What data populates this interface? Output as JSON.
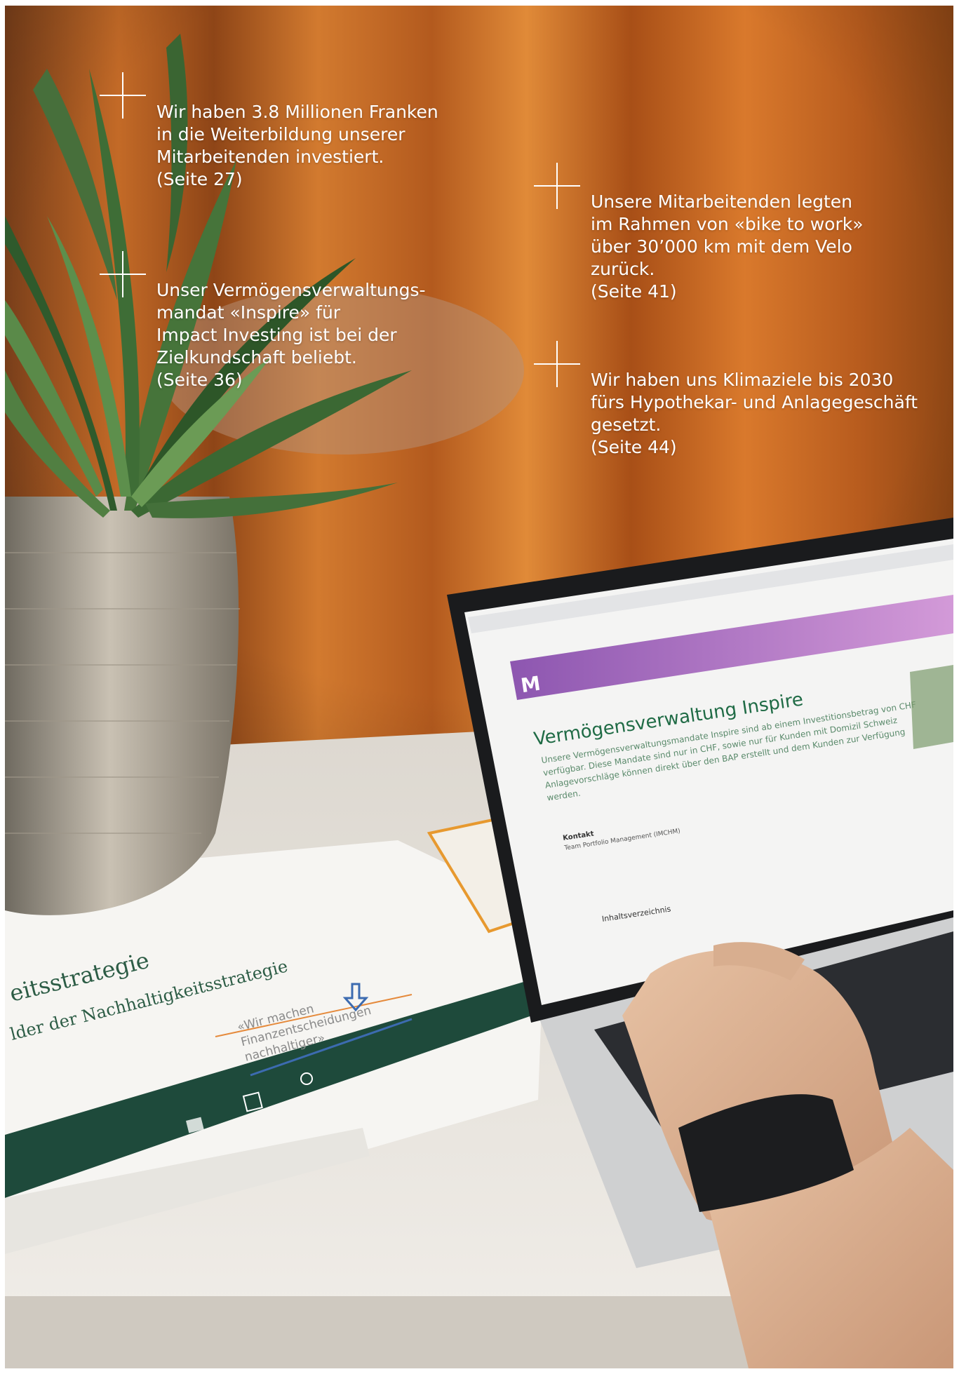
{
  "callouts": [
    {
      "lines": [
        "Wir haben 3.8 Millionen Franken",
        "in die Weiterbildung unserer",
        "Mitarbeitenden investiert.",
        "(Seite 27)"
      ]
    },
    {
      "lines": [
        "Unser Vermögensverwaltungs-",
        "mandat «Inspire» für",
        "Impact Investing ist bei der",
        "Zielkundschaft beliebt.",
        "(Seite 36)"
      ]
    },
    {
      "lines": [
        "Unsere Mitarbeitenden legten",
        "im Rahmen von «bike to work»",
        "über 30’000 km mit dem Velo",
        "zurück.",
        "(Seite 41)"
      ]
    },
    {
      "lines": [
        "Wir haben uns Klimaziele bis 2030",
        "fürs Hypothekar- und Anlagegeschäft",
        "gesetzt.",
        "(Seite 44)"
      ]
    }
  ],
  "laptop_screen": {
    "logo": "M",
    "heading": "Vermögensverwaltung Inspire",
    "paragraph_lines": [
      "Unsere Vermögensverwaltungsmandate Inspire sind ab einem Investitionsbetrag von CHF",
      "verfügbar. Diese Mandate sind nur in CHF, sowie nur für Kunden mit Domizil Schweiz",
      "Anlagevorschläge können direkt über den BAP erstellt und dem Kunden zur Verfügung",
      "werden."
    ],
    "contact_label": "Kontakt",
    "contact_value": "Team Portfolio Management (IMCHM)",
    "toc": "Inhaltsverzeichnis"
  },
  "document": {
    "heading1": "eitsstrategie",
    "heading2": "lder der Nachhaltigkeitsstrategie",
    "quote_lines": [
      "«Wir machen",
      "Finanzentscheidungen",
      "nachhaltiger»"
    ]
  },
  "colors": {
    "curtain": "#c9691f",
    "desk": "#e9e6e0",
    "header_bar": "#9a5fb3",
    "accent_green": "#1f6b45",
    "doc_band": "#1e4a3b"
  }
}
